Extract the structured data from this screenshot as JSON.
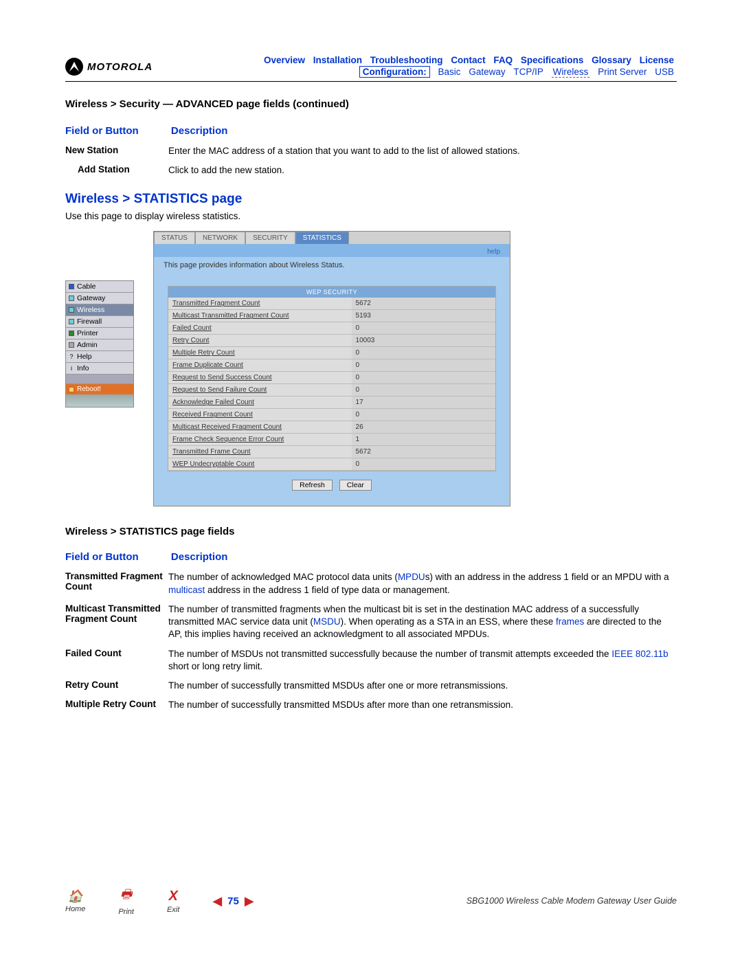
{
  "brand": "MOTOROLA",
  "topnav": [
    "Overview",
    "Installation",
    "Troubleshooting",
    "Contact",
    "FAQ",
    "Specifications",
    "Glossary",
    "License"
  ],
  "subnav": {
    "conf": "Configuration:",
    "items": [
      "Basic",
      "Gateway",
      "TCP/IP",
      "Wireless",
      "Print Server",
      "USB"
    ]
  },
  "breadcrumb1": "Wireless > Security — ADVANCED page fields (continued)",
  "tablehead": {
    "col1": "Field or Button",
    "col2": "Description"
  },
  "advanced_rows": [
    {
      "label": "New Station",
      "indent": false,
      "desc": "Enter the MAC address of a station that you want to add to the list of allowed stations."
    },
    {
      "label": "Add Station",
      "indent": true,
      "desc": "Click to add the new station."
    }
  ],
  "section2_title": "Wireless > STATISTICS page",
  "section2_intro": "Use this page to display wireless statistics.",
  "side_menu": [
    {
      "label": "Cable",
      "cls": "blue"
    },
    {
      "label": "Gateway",
      "cls": "cyan"
    },
    {
      "label": "Wireless",
      "cls": "cyan",
      "active": true
    },
    {
      "label": "Firewall",
      "cls": "cyan"
    },
    {
      "label": "Printer",
      "cls": "green"
    },
    {
      "label": "Admin",
      "cls": "grey"
    },
    {
      "label": "Help",
      "cls": "",
      "prefix": "?"
    },
    {
      "label": "Info",
      "cls": "",
      "prefix": "i"
    }
  ],
  "side_reboot": "Reboot!",
  "panel_tabs": [
    "STATUS",
    "NETWORK",
    "SECURITY",
    "STATISTICS"
  ],
  "panel_help": "help",
  "panel_intro": "This page provides information about Wireless Status.",
  "stats_title": "WEP SECURITY",
  "stats": [
    [
      "Transmitted Fragment Count",
      "5672"
    ],
    [
      "Multicast Transmitted Fragment Count",
      "5193"
    ],
    [
      "Failed Count",
      "0"
    ],
    [
      "Retry Count",
      "10003"
    ],
    [
      "Multiple Retry Count",
      "0"
    ],
    [
      "Frame Duplicate Count",
      "0"
    ],
    [
      "Request to Send Success Count",
      "0"
    ],
    [
      "Request to Send Failure Count",
      "0"
    ],
    [
      "Acknowledge Failed Count",
      "17"
    ],
    [
      "Received Fragment Count",
      "0"
    ],
    [
      "Multicast Received Fragment Count",
      "26"
    ],
    [
      "Frame Check Sequence Error Count",
      "1"
    ],
    [
      "Transmitted Frame Count",
      "5672"
    ],
    [
      "WEP Undecryptable Count",
      "0"
    ]
  ],
  "panel_buttons": {
    "refresh": "Refresh",
    "clear": "Clear"
  },
  "fields_title": "Wireless > STATISTICS page fields",
  "stats_rows": [
    {
      "label": "Transmitted Fragment Count",
      "desc_parts": [
        "The number of acknowledged MAC protocol data units (",
        "MPDU",
        "s) with an address in the address 1 field or an MPDU with a ",
        "multicast",
        " address in the address 1 field of type data or management."
      ]
    },
    {
      "label": "Multicast Transmitted Fragment Count",
      "desc_parts": [
        "The number of transmitted fragments when the multicast bit is set in the destination MAC address of a successfully transmitted MAC service data unit (",
        "MSDU",
        "). When operating as a STA in an ESS, where these ",
        "frames",
        " are directed to the AP, this implies having received an acknowledgment to all associated MPDUs."
      ]
    },
    {
      "label": "Failed Count",
      "desc_parts": [
        "The number of MSDUs not transmitted successfully because the number of transmit attempts exceeded the ",
        "IEEE 802.11b",
        " short or long retry limit."
      ]
    },
    {
      "label": "Retry Count",
      "desc_parts": [
        "The number of successfully transmitted MSDUs after one or more retransmissions."
      ]
    },
    {
      "label": "Multiple Retry Count",
      "desc_parts": [
        "The number of successfully transmitted MSDUs after more than one retransmission."
      ]
    }
  ],
  "footer": {
    "home": "Home",
    "print": "Print",
    "exit": "Exit",
    "page": "75",
    "guide": "SBG1000 Wireless Cable Modem Gateway User Guide"
  }
}
